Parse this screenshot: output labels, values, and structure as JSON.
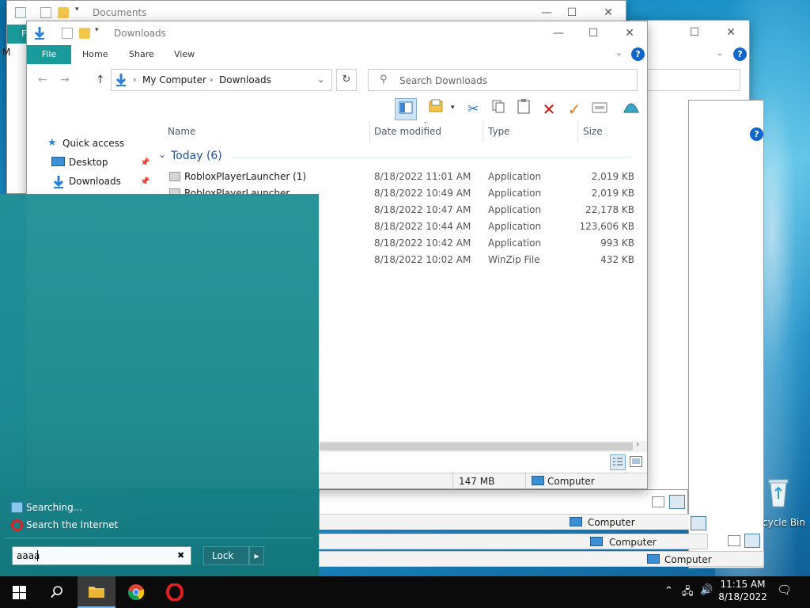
{
  "desktop": {
    "recycle_bin_label": "cycle Bin"
  },
  "back_window_documents": {
    "title": "Documents",
    "ribbon_tab_fragment": "F",
    "left_fragment": "M",
    "status_computer": "Computer"
  },
  "back_window_2": {
    "status_computer": "Computer"
  },
  "back_window_3": {
    "status_computer": "Computer"
  },
  "back_window_4": {
    "status_computer": "Computer"
  },
  "explorer": {
    "title": "Downloads",
    "tabs": [
      "File",
      "Home",
      "Share",
      "View"
    ],
    "help": "?",
    "breadcrumb": [
      "My Computer",
      "Downloads"
    ],
    "search_placeholder": "Search Downloads",
    "columns": {
      "name": "Name",
      "date": "Date modified",
      "type": "Type",
      "size": "Size"
    },
    "group_label": "Today (6)",
    "nav_tree": [
      {
        "label": "Quick access",
        "pinned": false
      },
      {
        "label": "Desktop",
        "pinned": true
      },
      {
        "label": "Downloads",
        "pinned": true
      }
    ],
    "files": [
      {
        "name": "RobloxPlayerLauncher (1)",
        "date": "8/18/2022 11:01 AM",
        "type": "Application",
        "size": "2,019 KB"
      },
      {
        "name": "RobloxPlayerLauncher",
        "date": "8/18/2022 10:49 AM",
        "type": "Application",
        "size": "2,019 KB"
      },
      {
        "name": "",
        "date": "8/18/2022 10:47 AM",
        "type": "Application",
        "size": "22,178 KB"
      },
      {
        "name": "",
        "date": "8/18/2022 10:44 AM",
        "type": "Application",
        "size": "123,606 KB"
      },
      {
        "name": "",
        "date": "8/18/2022 10:42 AM",
        "type": "Application",
        "size": "993 KB"
      },
      {
        "name": "",
        "date": "8/18/2022 10:02 AM",
        "type": "WinZip File",
        "size": "432 KB"
      }
    ],
    "status_size": "147 MB",
    "status_computer": "Computer"
  },
  "start_panel": {
    "searching_label": "Searching...",
    "search_internet_label": "Search the Internet",
    "search_value": "aaaa",
    "clear_glyph": "✖",
    "lock_label": "Lock",
    "lock_arrow": "▸"
  },
  "taskbar": {
    "time": "11:15 AM",
    "date": "8/18/2022"
  },
  "colors": {
    "ribbon_file_tab": "#1a9b9b",
    "start_panel": "#1a8d92",
    "taskbar": "#0b0b0b",
    "accent_blue": "#1166cc",
    "delete_red": "#cc1111"
  }
}
